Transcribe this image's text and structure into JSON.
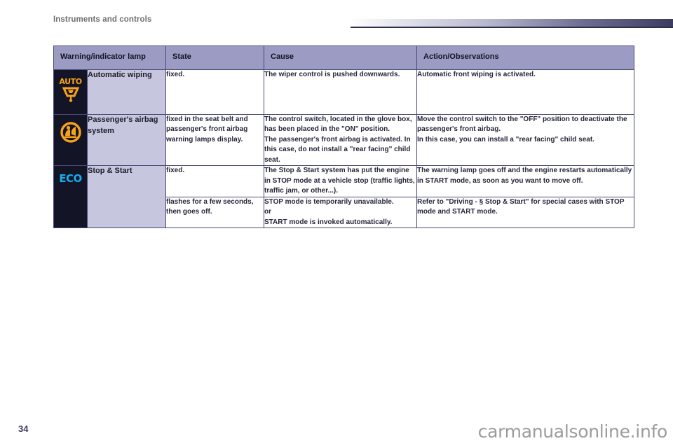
{
  "header": {
    "section_title": "Instruments and controls"
  },
  "table": {
    "columns": [
      "Warning/indicator lamp",
      "State",
      "Cause",
      "Action/Observations"
    ],
    "rows": [
      {
        "icon": "auto-wiping-icon",
        "icon_label": "AUTO",
        "name": "Automatic wiping",
        "state": "fixed.",
        "cause": "The wiper control is pushed downwards.",
        "action": "Automatic front wiping is activated."
      },
      {
        "icon": "passenger-airbag-icon",
        "icon_label": "",
        "name": "Passenger's airbag system",
        "state": "fixed in the seat belt and passenger's front airbag warning lamps display.",
        "cause_lines": [
          "The control switch, located in the glove box, has been placed in the \"ON\" position.",
          "The passenger's front airbag is activated. In this case, do not install a \"rear facing\" child seat."
        ],
        "action_lines": [
          "Move the control switch to the \"OFF\" position to deactivate the passenger's front airbag.",
          "In this case, you can install a \"rear facing\" child seat."
        ]
      },
      {
        "icon": "eco-stop-start-icon",
        "icon_label": "ECO",
        "name": "Stop & Start",
        "state": "fixed.",
        "cause": "The Stop & Start system has put the engine in STOP mode at a vehicle stop (traffic lights, traffic jam, or other...).",
        "action": "The warning lamp goes off and the engine restarts automatically in START mode, as soon as you want to move off."
      },
      {
        "icon": "",
        "icon_label": "",
        "name": "",
        "state": "flashes for a few seconds, then goes off.",
        "cause_lines": [
          "STOP mode is temporarily unavailable.",
          "or",
          "START mode is invoked automatically."
        ],
        "action": "Refer to \"Driving - § Stop & Start\" for special cases with STOP mode and START mode."
      }
    ]
  },
  "footer": {
    "page_number": "34",
    "watermark": "carmanualsonline.info"
  },
  "colors": {
    "header_row_bg": "#9b9bc4",
    "label_cell_bg": "#c6c6de",
    "icon_cell_bg": "#141427",
    "border": "#4a4a78",
    "auto_icon": "#f7a21b",
    "airbag_icon": "#f7a21b",
    "eco_icon": "#12b0ee",
    "page_number": "#3b3b63",
    "watermark": "#9c9c9c"
  }
}
